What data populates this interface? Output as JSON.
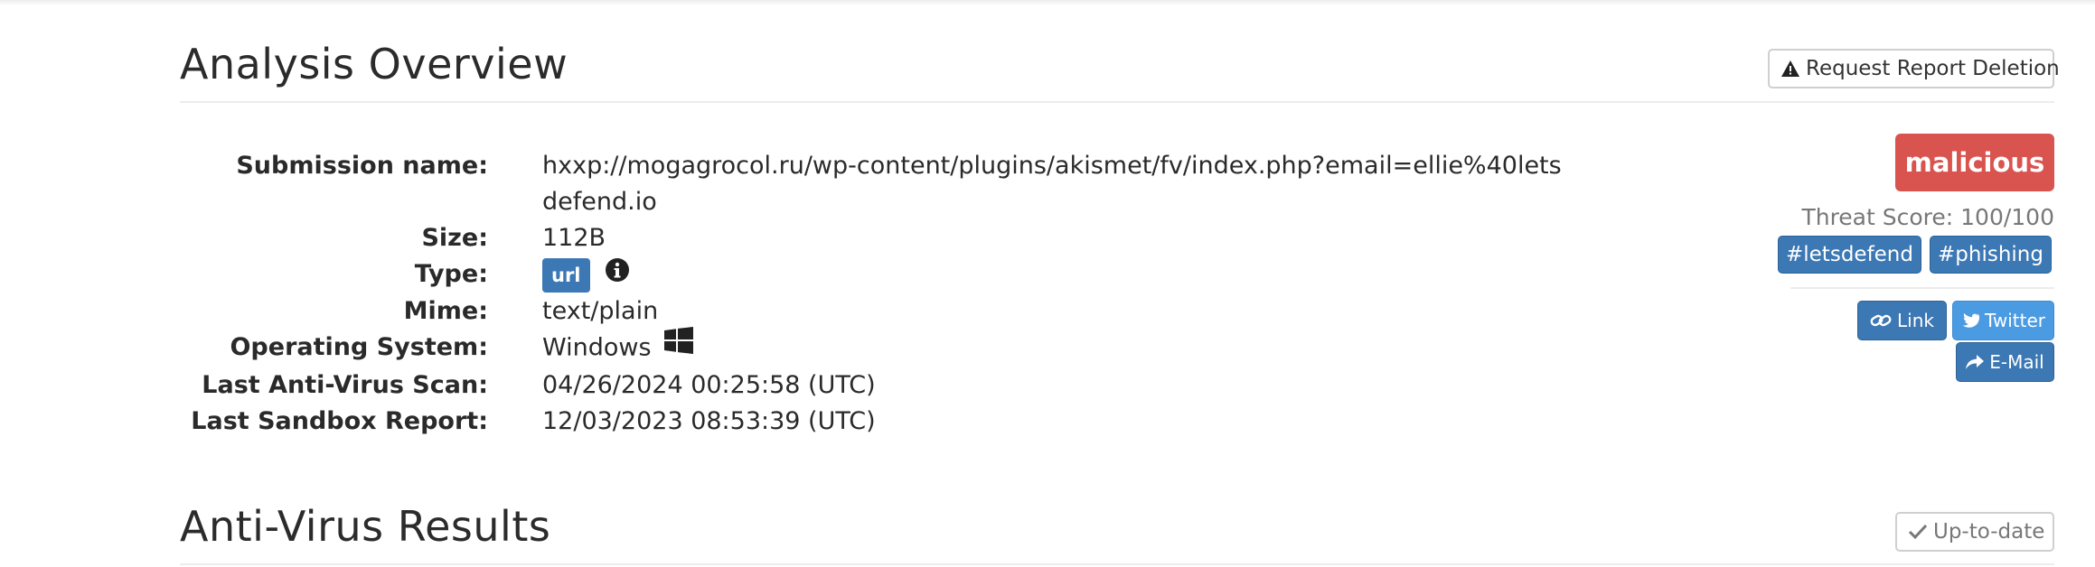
{
  "overview": {
    "title": "Analysis Overview",
    "request_deletion_label": "Request Report Deletion",
    "fields": {
      "submission_label": "Submission name:",
      "submission_line1": "hxxp://mogagrocol.ru/wp-content/plugins/akismet/fv/index.php?email=ellie%40lets",
      "submission_line2": "defend.io",
      "size_label": "Size:",
      "size_value": "112B",
      "type_label": "Type:",
      "type_value": "url",
      "mime_label": "Mime:",
      "mime_value": "text/plain",
      "os_label": "Operating System:",
      "os_value": "Windows",
      "av_scan_label": "Last Anti-Virus Scan:",
      "av_scan_value": "04/26/2024 00:25:58 (UTC)",
      "sandbox_label": "Last Sandbox Report:",
      "sandbox_value": "12/03/2023 08:53:39 (UTC)"
    },
    "verdict": "malicious",
    "threat_score": "Threat Score: 100/100",
    "tags": [
      "#letsdefend",
      "#phishing"
    ],
    "share": {
      "link_label": "Link",
      "twitter_label": "Twitter",
      "email_label": "E-Mail"
    }
  },
  "antivirus": {
    "title": "Anti-Virus Results",
    "status_label": "Up-to-date"
  },
  "colors": {
    "primary": "#3c78b4",
    "danger": "#d9534f",
    "twitter": "#4b9be3"
  }
}
